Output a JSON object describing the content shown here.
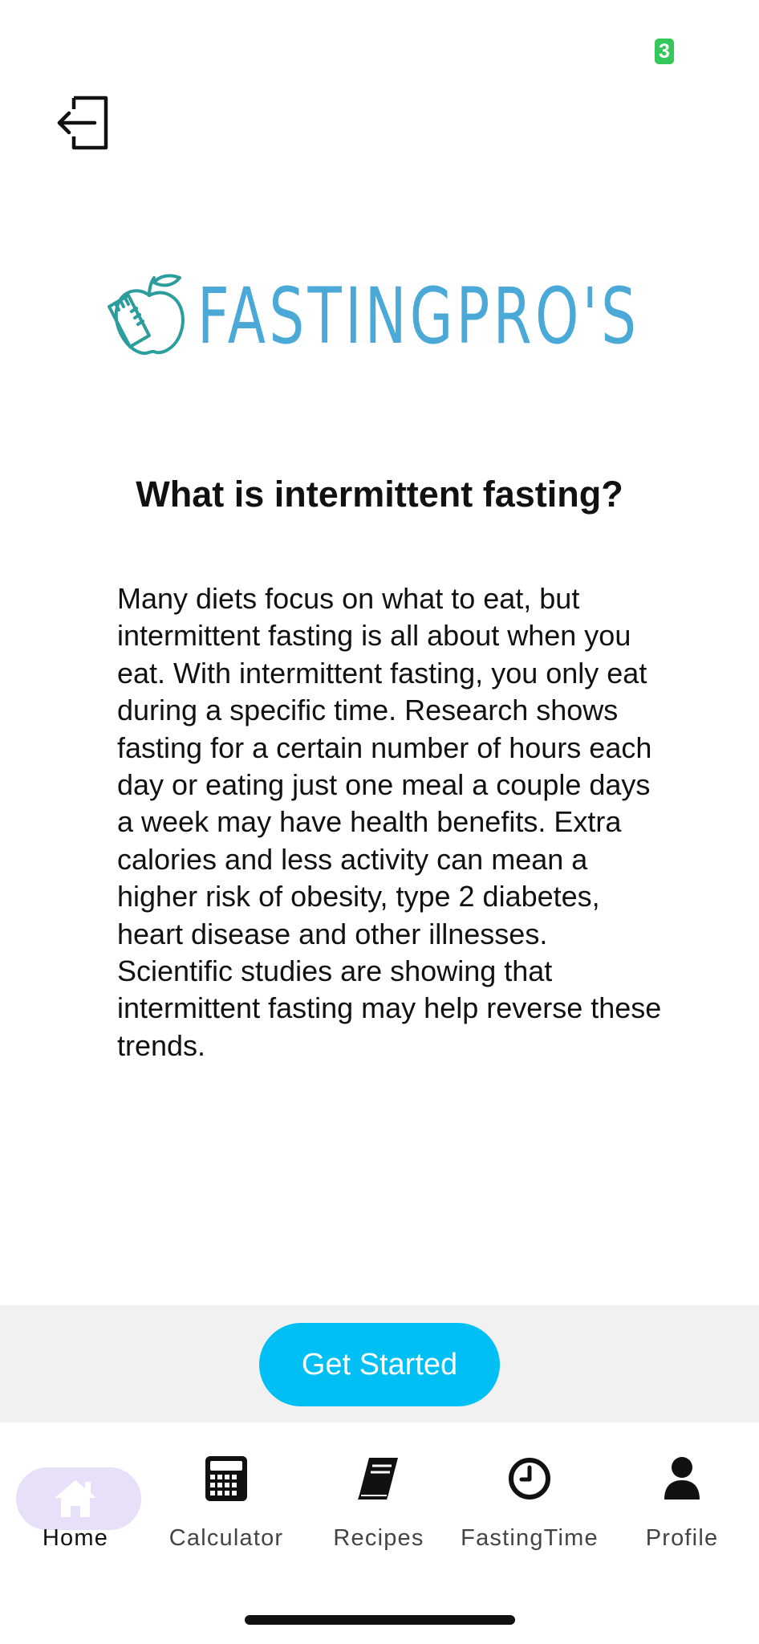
{
  "status": {
    "badge_count": "3",
    "badge_color": "#34c759"
  },
  "header": {
    "logout_icon": "logout-icon"
  },
  "logo": {
    "text": "FASTINGPRO'S",
    "icon": "apple-measuring-tape-icon",
    "color": "#4aa9d6"
  },
  "content": {
    "title": "What is intermittent fasting?",
    "body": "Many diets focus on what to eat, but intermittent fasting is all about when you eat. With intermittent fasting, you only eat during a specific time. Research shows fasting for a certain number of hours each day or eating just one meal a couple days a week may have health benefits. Extra calories and less activity can mean a higher risk of obesity, type 2 diabetes, heart disease and other illnesses. Scientific studies are showing that intermittent fasting may help reverse these trends."
  },
  "cta": {
    "label": "Get Started",
    "color": "#00bff5"
  },
  "tabs": [
    {
      "label": "Home",
      "icon": "home-icon",
      "active": true
    },
    {
      "label": "Calculator",
      "icon": "calculator-icon",
      "active": false
    },
    {
      "label": "Recipes",
      "icon": "book-icon",
      "active": false
    },
    {
      "label": "FastingTime",
      "icon": "clock-icon",
      "active": false
    },
    {
      "label": "Profile",
      "icon": "person-icon",
      "active": false
    }
  ],
  "colors": {
    "active_tab_pill": "#e8e0f8",
    "cta_bar_background": "#f1f1f1"
  }
}
